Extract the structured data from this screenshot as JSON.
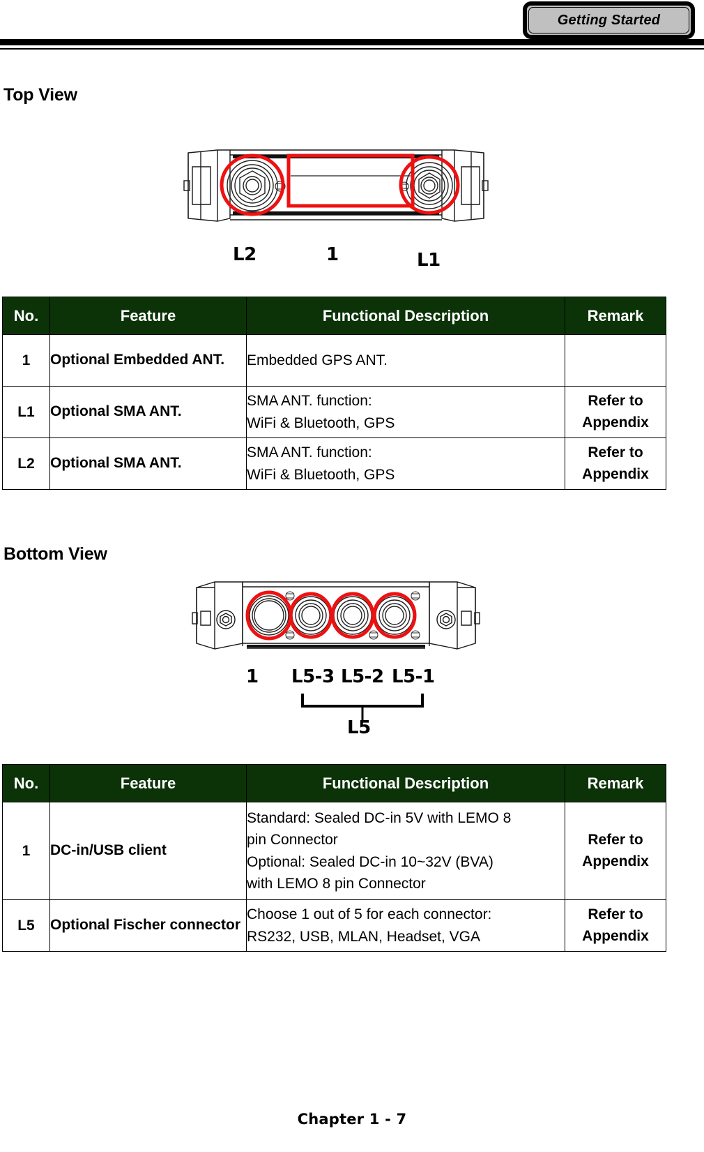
{
  "header": {
    "chapter_tab_label": "Getting Started"
  },
  "sections": {
    "top_view": {
      "title": "Top View",
      "callouts": [
        {
          "label": "L2"
        },
        {
          "label": "1"
        },
        {
          "label": "L1"
        }
      ]
    },
    "bottom_view": {
      "title": "Bottom View",
      "callouts": [
        {
          "label": "1"
        },
        {
          "label": "L5-3"
        },
        {
          "label": "L5-2"
        },
        {
          "label": "L5-1"
        }
      ],
      "bracket_label": "L5"
    }
  },
  "tables": {
    "columns": [
      "No.",
      "Feature",
      "Functional Description",
      "Remark"
    ],
    "top_view_table": {
      "headers": [
        "No.",
        "Feature",
        "Functional Description",
        "Remark"
      ],
      "rows": [
        {
          "no": "1",
          "feature": "Optional Embedded ANT.",
          "description_lines": [
            "Embedded GPS ANT."
          ],
          "remark_lines": []
        },
        {
          "no": "L1",
          "feature": "Optional SMA ANT.",
          "description_lines": [
            "SMA ANT. function:",
            "WiFi & Bluetooth, GPS"
          ],
          "remark_lines": [
            "Refer to",
            "Appendix"
          ]
        },
        {
          "no": "L2",
          "feature": "Optional SMA ANT.",
          "description_lines": [
            "SMA ANT. function:",
            "WiFi & Bluetooth, GPS"
          ],
          "remark_lines": [
            "Refer to",
            "Appendix"
          ]
        }
      ]
    },
    "bottom_view_table": {
      "headers": [
        "No.",
        "Feature",
        "Functional Description",
        "Remark"
      ],
      "rows": [
        {
          "no": "1",
          "feature": "DC-in/USB client",
          "description_lines": [
            "Standard: Sealed DC-in 5V with LEMO 8",
            "pin Connector",
            "Optional: Sealed DC-in 10~32V (BVA)",
            "with LEMO 8 pin Connector"
          ],
          "remark_lines": [
            "Refer to",
            "Appendix"
          ]
        },
        {
          "no": "L5",
          "feature": "Optional Fischer connector",
          "description_lines": [
            "Choose 1 out of 5 for each connector:",
            "RS232, USB, MLAN, Headset, VGA"
          ],
          "remark_lines": [
            "Refer to",
            "Appendix"
          ]
        }
      ]
    }
  },
  "footer": {
    "page_label": "Chapter 1 - 7"
  },
  "colors": {
    "table_header_bg": "#0b3307",
    "table_header_text": "#ffffff",
    "annotation_circle": "#ee1111",
    "tab_fill": "#c0c0c0",
    "rule": "#000000"
  }
}
